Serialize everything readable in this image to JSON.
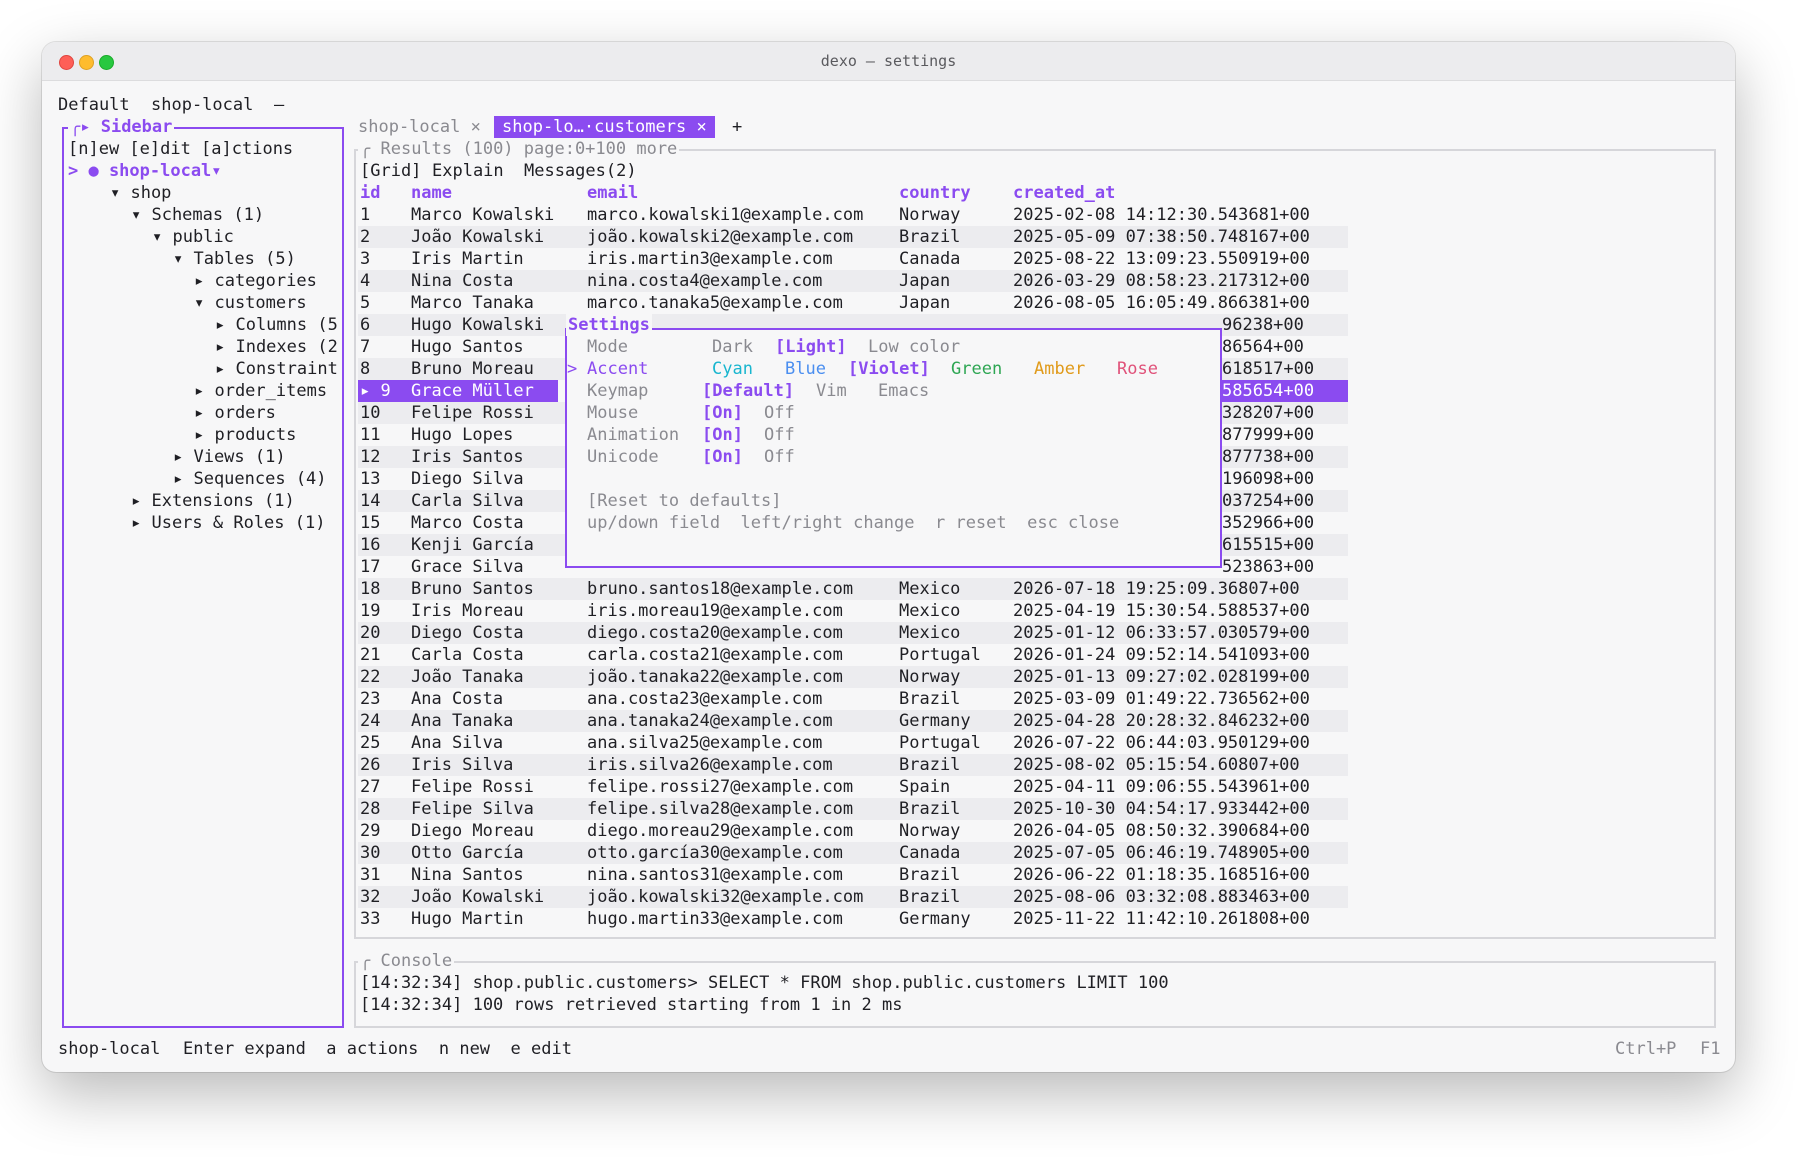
{
  "window": {
    "title": "dexo — settings"
  },
  "topbar": {
    "profile": "Default",
    "connection": "shop-local",
    "dash": "—"
  },
  "sidebar": {
    "legend": "Sidebar",
    "actions": "[n]ew [e]dit [a]ctions",
    "tree": [
      {
        "text": "> ● shop-local▾",
        "depth": 0,
        "selected": true
      },
      {
        "text": "▾ shop",
        "depth": 2
      },
      {
        "text": "▾ Schemas (1)",
        "depth": 3
      },
      {
        "text": "▾ public",
        "depth": 4
      },
      {
        "text": "▾ Tables (5)",
        "depth": 5
      },
      {
        "text": "▸ categories",
        "depth": 6
      },
      {
        "text": "▾ customers",
        "depth": 6
      },
      {
        "text": "▸ Columns (5",
        "depth": 7
      },
      {
        "text": "▸ Indexes (2",
        "depth": 7
      },
      {
        "text": "▸ Constraint",
        "depth": 7
      },
      {
        "text": "▸ order_items",
        "depth": 6
      },
      {
        "text": "▸ orders",
        "depth": 6
      },
      {
        "text": "▸ products",
        "depth": 6
      },
      {
        "text": "▸ Views (1)",
        "depth": 5
      },
      {
        "text": "▸ Sequences (4)",
        "depth": 5
      },
      {
        "text": "▸ Extensions (1)",
        "depth": 3
      },
      {
        "text": "▸ Users & Roles (1)",
        "depth": 3
      }
    ]
  },
  "tabs": {
    "tab1": "shop-local ×",
    "tab2": "shop-lo…·customers ×",
    "add": "+"
  },
  "results": {
    "legend": "Results (100) page:0+100 more",
    "subtabs": {
      "grid": "[Grid]",
      "explain": "Explain",
      "messages": "Messages(2)"
    },
    "columns": [
      "id",
      "name",
      "email",
      "country",
      "created_at"
    ],
    "rows": [
      [
        "1",
        "Marco Kowalski",
        "marco.kowalski1@example.com",
        "Norway",
        "2025-02-08 14:12:30.543681+00"
      ],
      [
        "2",
        "João Kowalski",
        "joão.kowalski2@example.com",
        "Brazil",
        "2025-05-09 07:38:50.748167+00"
      ],
      [
        "3",
        "Iris Martin",
        "iris.martin3@example.com",
        "Canada",
        "2025-08-22 13:09:23.550919+00"
      ],
      [
        "4",
        "Nina Costa",
        "nina.costa4@example.com",
        "Japan",
        "2026-03-29 08:58:23.217312+00"
      ],
      [
        "5",
        "Marco Tanaka",
        "marco.tanaka5@example.com",
        "Japan",
        "2026-08-05 16:05:49.866381+00"
      ],
      [
        "6",
        "Hugo Kowalski",
        "",
        "",
        "96238+00"
      ],
      [
        "7",
        "Hugo Santos",
        "",
        "",
        "86564+00"
      ],
      [
        "8",
        "Bruno Moreau",
        "",
        "",
        "618517+00"
      ],
      [
        "▸ 9",
        "Grace Müller",
        "",
        "",
        "585654+00"
      ],
      [
        "10",
        "Felipe Rossi",
        "",
        "",
        "328207+00"
      ],
      [
        "11",
        "Hugo Lopes",
        "",
        "",
        "877999+00"
      ],
      [
        "12",
        "Iris Santos",
        "",
        "",
        "877738+00"
      ],
      [
        "13",
        "Diego Silva",
        "",
        "",
        "196098+00"
      ],
      [
        "14",
        "Carla Silva",
        "",
        "",
        "037254+00"
      ],
      [
        "15",
        "Marco Costa",
        "",
        "",
        "352966+00"
      ],
      [
        "16",
        "Kenji García",
        "",
        "",
        "615515+00"
      ],
      [
        "17",
        "Grace Silva",
        "",
        "",
        "523863+00"
      ],
      [
        "18",
        "Bruno Santos",
        "bruno.santos18@example.com",
        "Mexico",
        "2026-07-18 19:25:09.36807+00"
      ],
      [
        "19",
        "Iris Moreau",
        "iris.moreau19@example.com",
        "Mexico",
        "2025-04-19 15:30:54.588537+00"
      ],
      [
        "20",
        "Diego Costa",
        "diego.costa20@example.com",
        "Mexico",
        "2025-01-12 06:33:57.030579+00"
      ],
      [
        "21",
        "Carla Costa",
        "carla.costa21@example.com",
        "Portugal",
        "2026-01-24 09:52:14.541093+00"
      ],
      [
        "22",
        "João Tanaka",
        "joão.tanaka22@example.com",
        "Norway",
        "2025-01-13 09:27:02.028199+00"
      ],
      [
        "23",
        "Ana Costa",
        "ana.costa23@example.com",
        "Brazil",
        "2025-03-09 01:49:22.736562+00"
      ],
      [
        "24",
        "Ana Tanaka",
        "ana.tanaka24@example.com",
        "Germany",
        "2025-04-28 20:28:32.846232+00"
      ],
      [
        "25",
        "Ana Silva",
        "ana.silva25@example.com",
        "Portugal",
        "2026-07-22 06:44:03.950129+00"
      ],
      [
        "26",
        "Iris Silva",
        "iris.silva26@example.com",
        "Brazil",
        "2025-08-02 05:15:54.60807+00"
      ],
      [
        "27",
        "Felipe Rossi",
        "felipe.rossi27@example.com",
        "Spain",
        "2025-04-11 09:06:55.543961+00"
      ],
      [
        "28",
        "Felipe Silva",
        "felipe.silva28@example.com",
        "Brazil",
        "2025-10-30 04:54:17.933442+00"
      ],
      [
        "29",
        "Diego Moreau",
        "diego.moreau29@example.com",
        "Norway",
        "2026-04-05 08:50:32.390684+00"
      ],
      [
        "30",
        "Otto García",
        "otto.garcía30@example.com",
        "Canada",
        "2025-07-05 06:46:19.748905+00"
      ],
      [
        "31",
        "Nina Santos",
        "nina.santos31@example.com",
        "Brazil",
        "2026-06-22 01:18:35.168516+00"
      ],
      [
        "32",
        "João Kowalski",
        "joão.kowalski32@example.com",
        "Brazil",
        "2025-08-06 03:32:08.883463+00"
      ],
      [
        "33",
        "Hugo Martin",
        "hugo.martin33@example.com",
        "Germany",
        "2025-11-22 11:42:10.261808+00"
      ]
    ]
  },
  "settings": {
    "title": "Settings",
    "mode": {
      "label": "Mode",
      "options": [
        "Dark",
        "[Light]",
        "Low color"
      ]
    },
    "accent": {
      "pointer": ">",
      "label": "Accent",
      "options": [
        "Cyan",
        "Blue",
        "[Violet]",
        "Green",
        "Amber",
        "Rose"
      ]
    },
    "keymap": {
      "label": "Keymap",
      "options": [
        "[Default]",
        "Vim",
        "Emacs"
      ]
    },
    "mouse": {
      "label": "Mouse",
      "on": "[On]",
      "off": "Off"
    },
    "animation": {
      "label": "Animation",
      "on": "[On]",
      "off": "Off"
    },
    "unicode": {
      "label": "Unicode",
      "on": "[On]",
      "off": "Off"
    },
    "reset": "[Reset to defaults]",
    "hints": "up/down field  left/right change  r reset  esc close"
  },
  "console": {
    "legend": "Console",
    "line1": "[14:32:34] shop.public.customers> SELECT * FROM shop.public.customers LIMIT 100",
    "line2": "[14:32:34] 100 rows retrieved starting from 1 in 2 ms"
  },
  "statusbar": {
    "connection": "shop-local",
    "hints": "Enter expand  a actions  n new  e edit",
    "palette": "Ctrl+P",
    "help": "F1"
  },
  "colors": {
    "accent": "#8b4bf0",
    "cyan": "#19b6cf",
    "blue": "#4a8ef0",
    "green": "#2ea653",
    "amber": "#e09a1a",
    "rose": "#e0527a"
  }
}
